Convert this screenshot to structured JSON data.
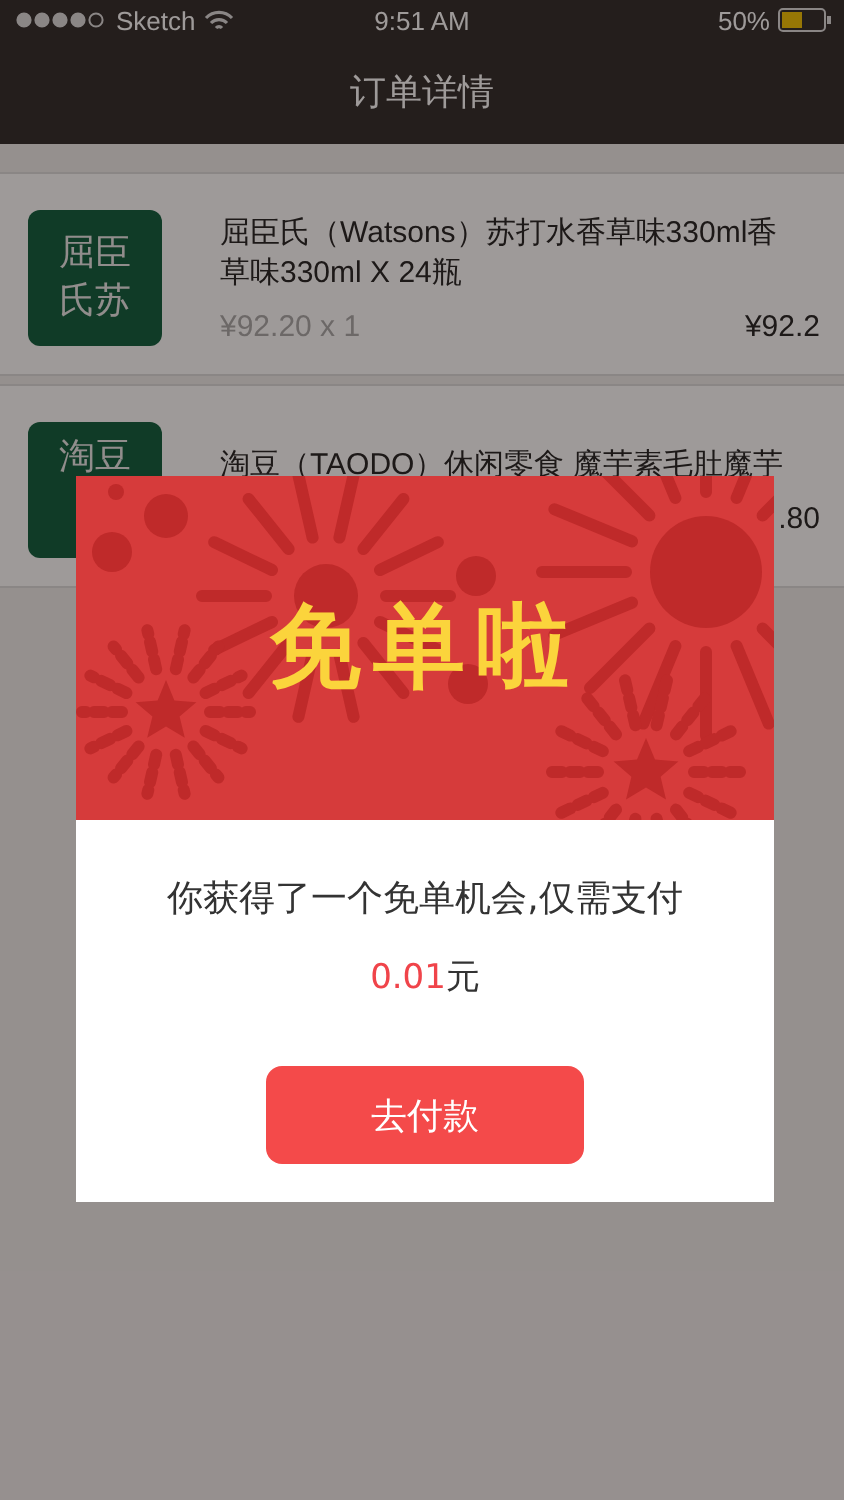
{
  "status_bar": {
    "carrier": "Sketch",
    "time": "9:51 AM",
    "battery": "50%"
  },
  "nav": {
    "title": "订单详情"
  },
  "items": [
    {
      "logo": [
        "屈臣",
        "氏苏"
      ],
      "title": "屈臣氏（Watsons）苏打水香草味330ml香草味330ml X 24瓶",
      "unit_price": "¥92.20 x 1",
      "price": "¥92.2"
    },
    {
      "logo": [
        "淘豆"
      ],
      "title": "淘豆（TAODO）休闲零食 魔芋素毛肚魔芋",
      "price": ".80"
    }
  ],
  "dialog": {
    "banner_title": "免单啦",
    "message": "你获得了一个免单机会,仅需支付",
    "amount": "0.01",
    "currency": "元",
    "button": "去付款"
  }
}
